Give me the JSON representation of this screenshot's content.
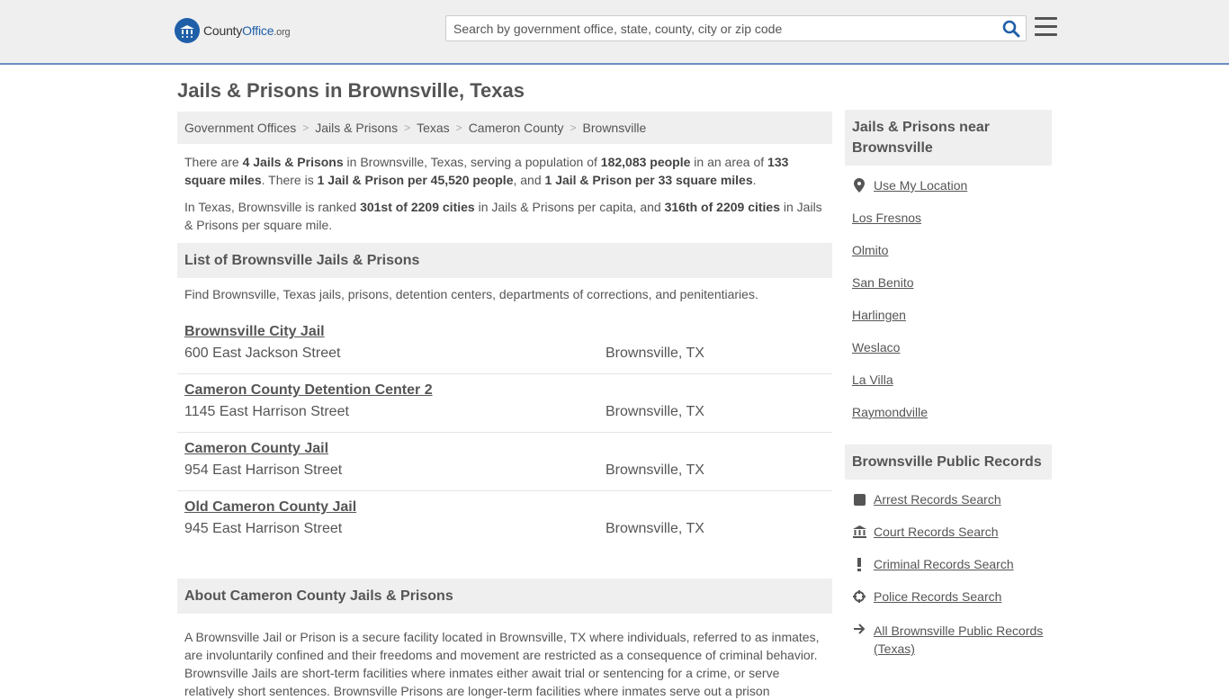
{
  "header": {
    "logo_main": "County",
    "logo_accent": "Office",
    "logo_tld": ".org",
    "search_placeholder": "Search by government office, state, county, city or zip code"
  },
  "page_title": "Jails & Prisons in Brownsville, Texas",
  "breadcrumbs": [
    "Government Offices",
    "Jails & Prisons",
    "Texas",
    "Cameron County",
    "Brownsville"
  ],
  "intro": {
    "p1": {
      "t1": "There are ",
      "b1": "4 Jails & Prisons",
      "t2": " in Brownsville, Texas, serving a population of ",
      "b2": "182,083 people",
      "t3": " in an area of ",
      "b3": "133 square miles",
      "t4": ". There is ",
      "b4": "1 Jail & Prison per 45,520 people",
      "t5": ", and ",
      "b5": "1 Jail & Prison per 33 square miles",
      "t6": "."
    },
    "p2": {
      "t1": "In Texas, Brownsville is ranked ",
      "b1": "301st of 2209 cities",
      "t2": " in Jails & Prisons per capita, and ",
      "b2": "316th of 2209 cities",
      "t3": " in Jails & Prisons per square mile."
    }
  },
  "list": {
    "heading": "List of Brownsville Jails & Prisons",
    "description": "Find Brownsville, Texas jails, prisons, detention centers, departments of corrections, and penitentiaries.",
    "items": [
      {
        "name": "Brownsville City Jail",
        "address": "600 East Jackson Street",
        "city": "Brownsville, TX"
      },
      {
        "name": "Cameron County Detention Center 2",
        "address": "1145 East Harrison Street",
        "city": "Brownsville, TX"
      },
      {
        "name": "Cameron County Jail",
        "address": "954 East Harrison Street",
        "city": "Brownsville, TX"
      },
      {
        "name": "Old Cameron County Jail",
        "address": "945 East Harrison Street",
        "city": "Brownsville, TX"
      }
    ]
  },
  "about": {
    "heading": "About Cameron County Jails & Prisons",
    "text": "A Brownsville Jail or Prison is a secure facility located in Brownsville, TX where individuals, referred to as inmates, are involuntarily confined and their freedoms and movement are restricted as a consequence of criminal behavior. Brownsville Jails are short-term facilities where inmates either await trial or sentencing for a crime, or serve relatively short sentences. Brownsville Prisons are longer-term facilities where inmates serve out a prison"
  },
  "sidebar": {
    "nearby_heading": "Jails & Prisons near Brownsville",
    "use_location": "Use My Location",
    "nearby": [
      "Los Fresnos",
      "Olmito",
      "San Benito",
      "Harlingen",
      "Weslaco",
      "La Villa",
      "Raymondville"
    ],
    "records_heading": "Brownsville Public Records",
    "records": [
      {
        "label": "Arrest Records Search",
        "icon": "arrest-icon"
      },
      {
        "label": "Court Records Search",
        "icon": "courthouse-icon"
      },
      {
        "label": "Criminal Records Search",
        "icon": "exclamation-icon"
      },
      {
        "label": "Police Records Search",
        "icon": "crosshair-icon"
      },
      {
        "label": "All Brownsville Public Records (Texas)",
        "icon": "arrow-right-icon"
      }
    ]
  },
  "colors": {
    "accent_blue": "#1f5fa8",
    "header_bg": "#efefef",
    "header_border": "#6a8fc4"
  }
}
